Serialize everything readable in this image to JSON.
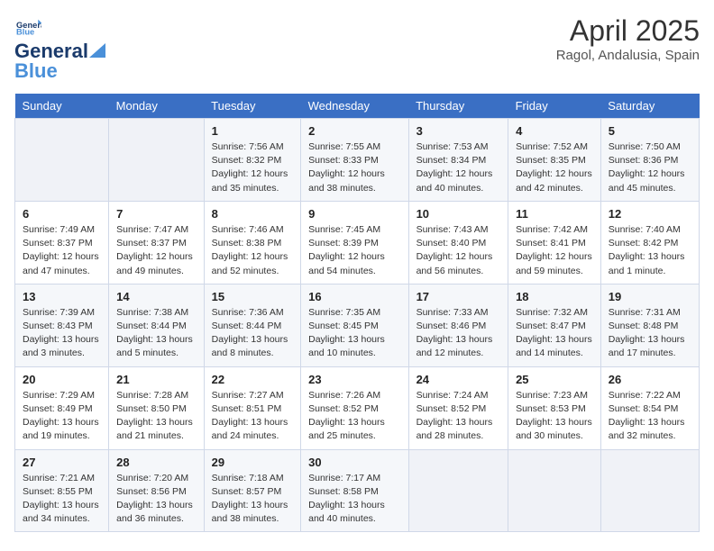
{
  "logo": {
    "line1": "General",
    "line2": "Blue"
  },
  "title": "April 2025",
  "subtitle": "Ragol, Andalusia, Spain",
  "days_of_week": [
    "Sunday",
    "Monday",
    "Tuesday",
    "Wednesday",
    "Thursday",
    "Friday",
    "Saturday"
  ],
  "weeks": [
    [
      {
        "day": null
      },
      {
        "day": null
      },
      {
        "day": 1,
        "sunrise": "Sunrise: 7:56 AM",
        "sunset": "Sunset: 8:32 PM",
        "daylight": "Daylight: 12 hours and 35 minutes."
      },
      {
        "day": 2,
        "sunrise": "Sunrise: 7:55 AM",
        "sunset": "Sunset: 8:33 PM",
        "daylight": "Daylight: 12 hours and 38 minutes."
      },
      {
        "day": 3,
        "sunrise": "Sunrise: 7:53 AM",
        "sunset": "Sunset: 8:34 PM",
        "daylight": "Daylight: 12 hours and 40 minutes."
      },
      {
        "day": 4,
        "sunrise": "Sunrise: 7:52 AM",
        "sunset": "Sunset: 8:35 PM",
        "daylight": "Daylight: 12 hours and 42 minutes."
      },
      {
        "day": 5,
        "sunrise": "Sunrise: 7:50 AM",
        "sunset": "Sunset: 8:36 PM",
        "daylight": "Daylight: 12 hours and 45 minutes."
      }
    ],
    [
      {
        "day": 6,
        "sunrise": "Sunrise: 7:49 AM",
        "sunset": "Sunset: 8:37 PM",
        "daylight": "Daylight: 12 hours and 47 minutes."
      },
      {
        "day": 7,
        "sunrise": "Sunrise: 7:47 AM",
        "sunset": "Sunset: 8:37 PM",
        "daylight": "Daylight: 12 hours and 49 minutes."
      },
      {
        "day": 8,
        "sunrise": "Sunrise: 7:46 AM",
        "sunset": "Sunset: 8:38 PM",
        "daylight": "Daylight: 12 hours and 52 minutes."
      },
      {
        "day": 9,
        "sunrise": "Sunrise: 7:45 AM",
        "sunset": "Sunset: 8:39 PM",
        "daylight": "Daylight: 12 hours and 54 minutes."
      },
      {
        "day": 10,
        "sunrise": "Sunrise: 7:43 AM",
        "sunset": "Sunset: 8:40 PM",
        "daylight": "Daylight: 12 hours and 56 minutes."
      },
      {
        "day": 11,
        "sunrise": "Sunrise: 7:42 AM",
        "sunset": "Sunset: 8:41 PM",
        "daylight": "Daylight: 12 hours and 59 minutes."
      },
      {
        "day": 12,
        "sunrise": "Sunrise: 7:40 AM",
        "sunset": "Sunset: 8:42 PM",
        "daylight": "Daylight: 13 hours and 1 minute."
      }
    ],
    [
      {
        "day": 13,
        "sunrise": "Sunrise: 7:39 AM",
        "sunset": "Sunset: 8:43 PM",
        "daylight": "Daylight: 13 hours and 3 minutes."
      },
      {
        "day": 14,
        "sunrise": "Sunrise: 7:38 AM",
        "sunset": "Sunset: 8:44 PM",
        "daylight": "Daylight: 13 hours and 5 minutes."
      },
      {
        "day": 15,
        "sunrise": "Sunrise: 7:36 AM",
        "sunset": "Sunset: 8:44 PM",
        "daylight": "Daylight: 13 hours and 8 minutes."
      },
      {
        "day": 16,
        "sunrise": "Sunrise: 7:35 AM",
        "sunset": "Sunset: 8:45 PM",
        "daylight": "Daylight: 13 hours and 10 minutes."
      },
      {
        "day": 17,
        "sunrise": "Sunrise: 7:33 AM",
        "sunset": "Sunset: 8:46 PM",
        "daylight": "Daylight: 13 hours and 12 minutes."
      },
      {
        "day": 18,
        "sunrise": "Sunrise: 7:32 AM",
        "sunset": "Sunset: 8:47 PM",
        "daylight": "Daylight: 13 hours and 14 minutes."
      },
      {
        "day": 19,
        "sunrise": "Sunrise: 7:31 AM",
        "sunset": "Sunset: 8:48 PM",
        "daylight": "Daylight: 13 hours and 17 minutes."
      }
    ],
    [
      {
        "day": 20,
        "sunrise": "Sunrise: 7:29 AM",
        "sunset": "Sunset: 8:49 PM",
        "daylight": "Daylight: 13 hours and 19 minutes."
      },
      {
        "day": 21,
        "sunrise": "Sunrise: 7:28 AM",
        "sunset": "Sunset: 8:50 PM",
        "daylight": "Daylight: 13 hours and 21 minutes."
      },
      {
        "day": 22,
        "sunrise": "Sunrise: 7:27 AM",
        "sunset": "Sunset: 8:51 PM",
        "daylight": "Daylight: 13 hours and 24 minutes."
      },
      {
        "day": 23,
        "sunrise": "Sunrise: 7:26 AM",
        "sunset": "Sunset: 8:52 PM",
        "daylight": "Daylight: 13 hours and 25 minutes."
      },
      {
        "day": 24,
        "sunrise": "Sunrise: 7:24 AM",
        "sunset": "Sunset: 8:52 PM",
        "daylight": "Daylight: 13 hours and 28 minutes."
      },
      {
        "day": 25,
        "sunrise": "Sunrise: 7:23 AM",
        "sunset": "Sunset: 8:53 PM",
        "daylight": "Daylight: 13 hours and 30 minutes."
      },
      {
        "day": 26,
        "sunrise": "Sunrise: 7:22 AM",
        "sunset": "Sunset: 8:54 PM",
        "daylight": "Daylight: 13 hours and 32 minutes."
      }
    ],
    [
      {
        "day": 27,
        "sunrise": "Sunrise: 7:21 AM",
        "sunset": "Sunset: 8:55 PM",
        "daylight": "Daylight: 13 hours and 34 minutes."
      },
      {
        "day": 28,
        "sunrise": "Sunrise: 7:20 AM",
        "sunset": "Sunset: 8:56 PM",
        "daylight": "Daylight: 13 hours and 36 minutes."
      },
      {
        "day": 29,
        "sunrise": "Sunrise: 7:18 AM",
        "sunset": "Sunset: 8:57 PM",
        "daylight": "Daylight: 13 hours and 38 minutes."
      },
      {
        "day": 30,
        "sunrise": "Sunrise: 7:17 AM",
        "sunset": "Sunset: 8:58 PM",
        "daylight": "Daylight: 13 hours and 40 minutes."
      },
      {
        "day": null
      },
      {
        "day": null
      },
      {
        "day": null
      }
    ]
  ]
}
